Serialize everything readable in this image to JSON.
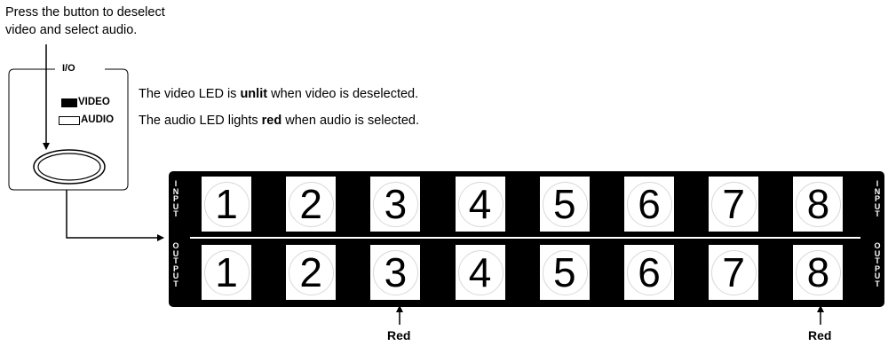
{
  "instruction": {
    "line1": "Press the button to deselect",
    "line2": "video and select audio."
  },
  "io_panel": {
    "title": "I/O",
    "video_led": "VIDEO",
    "audio_led": "AUDIO"
  },
  "notes": {
    "video_pre": "The video LED is ",
    "video_bold": "unlit",
    "video_post": " when video is deselected.",
    "audio_pre": "The audio LED lights ",
    "audio_bold": "red",
    "audio_post": " when audio is selected."
  },
  "panel": {
    "input_label": [
      "I",
      "N",
      "P",
      "U",
      "T"
    ],
    "output_label": [
      "O",
      "U",
      "T",
      "P",
      "U",
      "T"
    ],
    "input_buttons": [
      "1",
      "2",
      "3",
      "4",
      "5",
      "6",
      "7",
      "8"
    ],
    "output_buttons": [
      "1",
      "2",
      "3",
      "4",
      "5",
      "6",
      "7",
      "8"
    ]
  },
  "callouts": [
    "Red",
    "Red"
  ]
}
